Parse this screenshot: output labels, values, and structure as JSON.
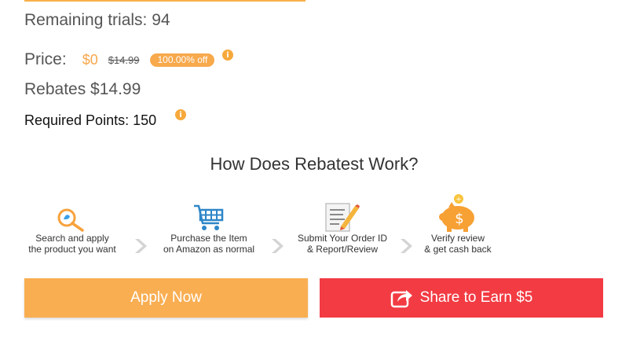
{
  "product": {
    "remaining_trials": "Remaining trials: 94",
    "price_label": "Price:",
    "price_now": "$0",
    "price_old": "$14.99",
    "discount": "100.00% off",
    "rebates": "Rebates $14.99",
    "required_points": "Required Points: 150"
  },
  "how": {
    "title": "How Does Rebatest Work?",
    "steps": [
      {
        "line1": "Search and apply",
        "line2": "the product you want",
        "icon": "search-icon"
      },
      {
        "line1": "Purchase the Item",
        "line2": "on Amazon as normal",
        "icon": "cart-icon"
      },
      {
        "line1": "Submit Your Order ID",
        "line2": "& Report/Review",
        "icon": "report-icon"
      },
      {
        "line1": "Verify review",
        "line2": "& get cash back",
        "icon": "piggy-bank-icon"
      }
    ]
  },
  "actions": {
    "apply_label": "Apply Now",
    "share_label": "Share to Earn $5"
  },
  "colors": {
    "accent_orange": "#f9ae52",
    "accent_red": "#f23b43",
    "info_orange": "#f6a93b"
  }
}
